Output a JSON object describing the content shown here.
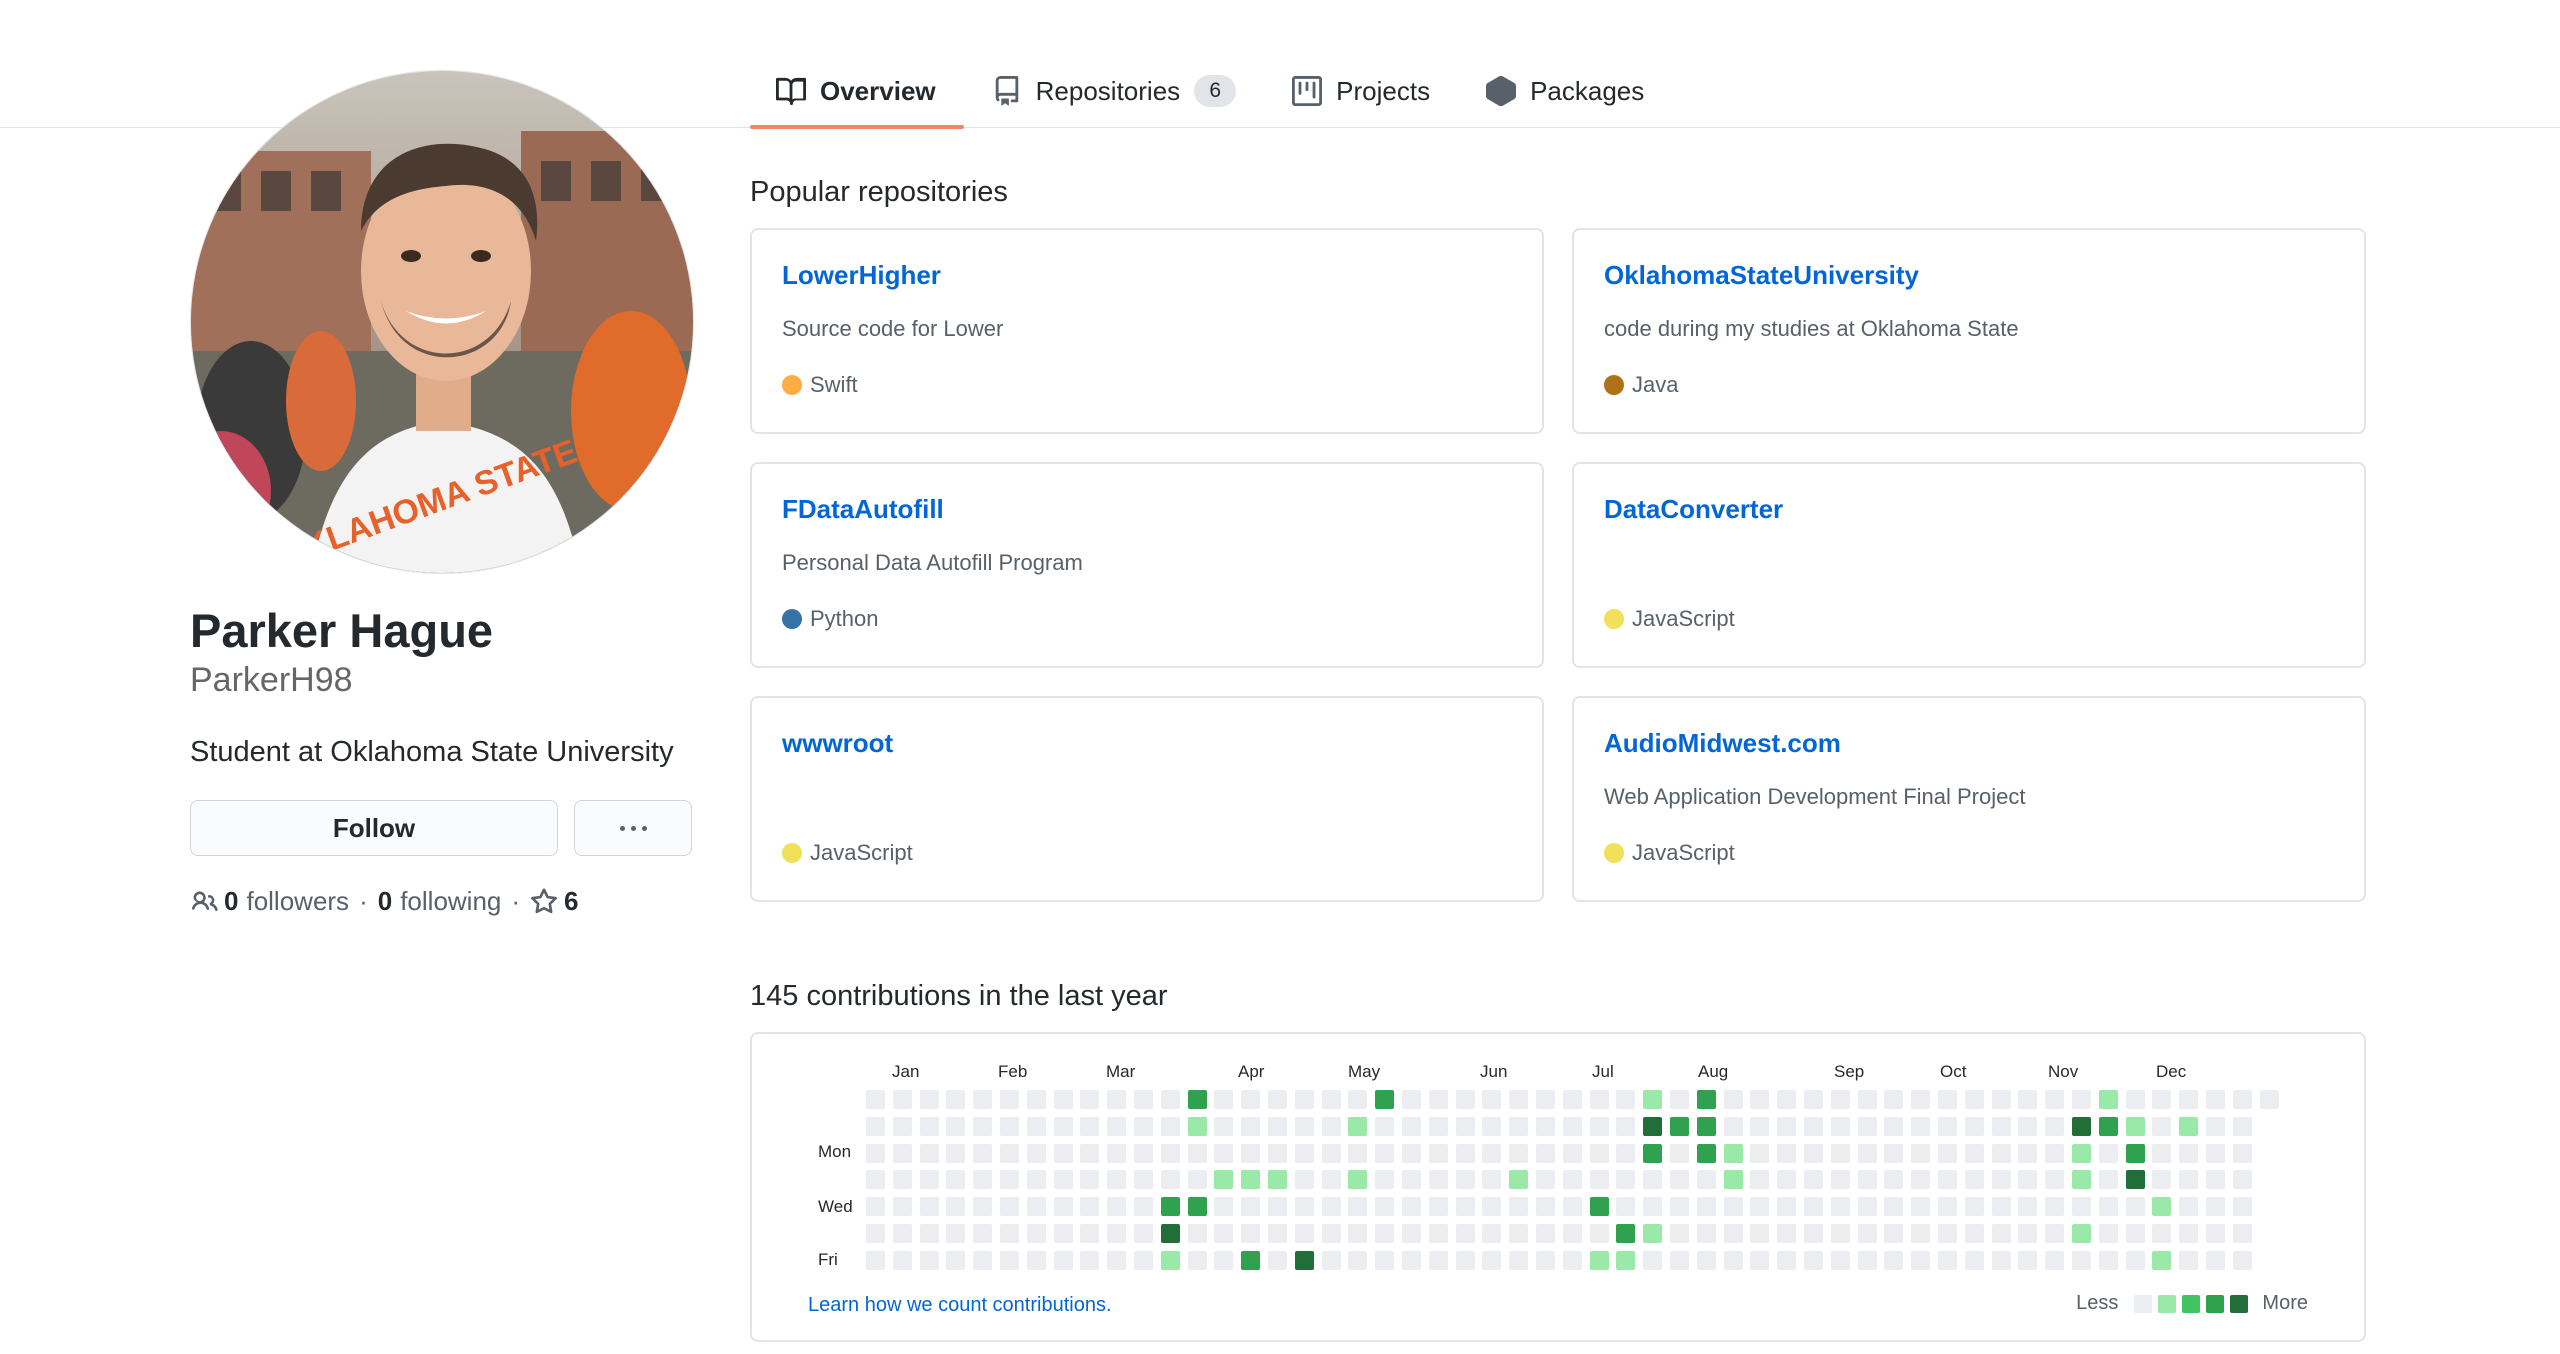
{
  "nav": {
    "tabs": [
      {
        "label": "Overview",
        "icon": "book-icon",
        "selected": true
      },
      {
        "label": "Repositories",
        "icon": "repo-icon",
        "count": "6"
      },
      {
        "label": "Projects",
        "icon": "project-icon"
      },
      {
        "label": "Packages",
        "icon": "package-icon"
      }
    ]
  },
  "profile": {
    "full_name": "Parker Hague",
    "username": "ParkerH98",
    "bio": "Student at Oklahoma State University",
    "follow_label": "Follow",
    "followers_count": "0",
    "followers_label": "followers",
    "following_count": "0",
    "following_label": "following",
    "stars_count": "6",
    "avatar_shirt_text": "OKLAHOMA STATE"
  },
  "popular": {
    "title": "Popular repositories",
    "repos": [
      {
        "name": "LowerHigher",
        "description": "Source code for Lower",
        "language": "Swift",
        "lang_color": "#ffac45"
      },
      {
        "name": "OklahomaStateUniversity",
        "description": "code during my studies at Oklahoma State",
        "language": "Java",
        "lang_color": "#b07219"
      },
      {
        "name": "FDataAutofill",
        "description": "Personal Data Autofill Program",
        "language": "Python",
        "lang_color": "#3572A5"
      },
      {
        "name": "DataConverter",
        "description": "",
        "language": "JavaScript",
        "lang_color": "#f1e05a"
      },
      {
        "name": "wwwroot",
        "description": "",
        "language": "JavaScript",
        "lang_color": "#f1e05a"
      },
      {
        "name": "AudioMidwest.com",
        "description": "Web Application Development Final Project",
        "language": "JavaScript",
        "lang_color": "#f1e05a"
      }
    ]
  },
  "contributions": {
    "title": "145 contributions in the last year",
    "months": [
      "Jan",
      "Feb",
      "Mar",
      "Apr",
      "May",
      "Jun",
      "Jul",
      "Aug",
      "Sep",
      "Oct",
      "Nov",
      "Dec"
    ],
    "days": [
      "Mon",
      "Wed",
      "Fri"
    ],
    "learn_link": "Learn how we count contributions.",
    "legend_less": "Less",
    "legend_more": "More",
    "colors": [
      "#ebedf0",
      "#9be9a8",
      "#40c463",
      "#30a14e",
      "#216e39"
    ],
    "weeks": 53,
    "last_week_days": 1,
    "activity": [
      [
        12,
        0,
        3
      ],
      [
        12,
        1,
        1
      ],
      [
        11,
        4,
        3
      ],
      [
        11,
        5,
        4
      ],
      [
        12,
        4,
        3
      ],
      [
        11,
        6,
        1
      ],
      [
        13,
        3,
        1
      ],
      [
        14,
        3,
        1
      ],
      [
        15,
        3,
        1
      ],
      [
        14,
        6,
        3
      ],
      [
        16,
        6,
        4
      ],
      [
        18,
        1,
        1
      ],
      [
        18,
        3,
        1
      ],
      [
        19,
        0,
        3
      ],
      [
        24,
        3,
        1
      ],
      [
        27,
        4,
        3
      ],
      [
        27,
        6,
        1
      ],
      [
        28,
        5,
        3
      ],
      [
        28,
        6,
        1
      ],
      [
        29,
        0,
        1
      ],
      [
        29,
        1,
        4
      ],
      [
        29,
        2,
        3
      ],
      [
        29,
        5,
        1
      ],
      [
        30,
        1,
        3
      ],
      [
        31,
        0,
        3
      ],
      [
        31,
        1,
        3
      ],
      [
        31,
        2,
        3
      ],
      [
        32,
        2,
        1
      ],
      [
        32,
        3,
        1
      ],
      [
        45,
        1,
        4
      ],
      [
        45,
        2,
        1
      ],
      [
        45,
        3,
        1
      ],
      [
        45,
        5,
        1
      ],
      [
        46,
        0,
        1
      ],
      [
        46,
        1,
        3
      ],
      [
        47,
        1,
        1
      ],
      [
        47,
        2,
        3
      ],
      [
        47,
        3,
        4
      ],
      [
        48,
        4,
        1
      ],
      [
        48,
        6,
        1
      ],
      [
        49,
        1,
        1
      ]
    ]
  }
}
